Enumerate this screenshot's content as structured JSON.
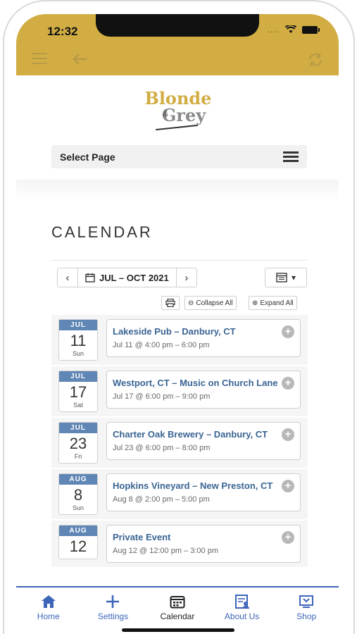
{
  "status_bar": {
    "time": "12:32",
    "signal": "....",
    "wifi_icon": "wifi-icon",
    "battery_icon": "battery-icon"
  },
  "app_bar": {
    "menu_icon": "hamburger-icon",
    "back_icon": "arrow-left-icon",
    "refresh_icon": "refresh-icon"
  },
  "logo": {
    "line1": "Blonde",
    "amp": "&",
    "line2": "Grey"
  },
  "nav": {
    "select_label": "Select Page"
  },
  "calendar": {
    "title": "CALENDAR",
    "prev": "‹",
    "next": "›",
    "range": "JUL – OCT 2021",
    "view_icon": "calendar-grid-icon",
    "collapse_label": "Collapse All",
    "expand_label": "Expand All",
    "events": [
      {
        "month": "JUL",
        "day": "11",
        "weekday": "Sun",
        "title": "Lakeside Pub – Danbury, CT",
        "when": "Jul 11 @ 4:00 pm – 6:00 pm"
      },
      {
        "month": "JUL",
        "day": "17",
        "weekday": "Sat",
        "title": "Westport, CT – Music on Church Lane",
        "when": "Jul 17 @ 6:00 pm – 9:00 pm"
      },
      {
        "month": "JUL",
        "day": "23",
        "weekday": "Fri",
        "title": "Charter Oak Brewery – Danbury, CT",
        "when": "Jul 23 @ 6:00 pm – 8:00 pm"
      },
      {
        "month": "AUG",
        "day": "8",
        "weekday": "Sun",
        "title": "Hopkins Vineyard – New Preston, CT",
        "when": "Aug 8 @ 2:00 pm – 5:00 pm"
      },
      {
        "month": "AUG",
        "day": "12",
        "weekday": "",
        "title": "Private Event",
        "when": "Aug 12 @ 12:00 pm – 3:00 pm"
      }
    ]
  },
  "tabbar": {
    "items": [
      {
        "label": "Home",
        "icon": "home-icon"
      },
      {
        "label": "Settings",
        "icon": "plus-icon"
      },
      {
        "label": "Calendar",
        "icon": "calendar-icon"
      },
      {
        "label": "About Us",
        "icon": "contact-card-icon"
      },
      {
        "label": "Shop",
        "icon": "shop-icon"
      }
    ],
    "active": "Calendar"
  },
  "colors": {
    "gold": "#d1ad43",
    "accent_blue": "#3d66b8",
    "title_blue": "#3a6493",
    "badge_blue": "#5f86b5"
  }
}
